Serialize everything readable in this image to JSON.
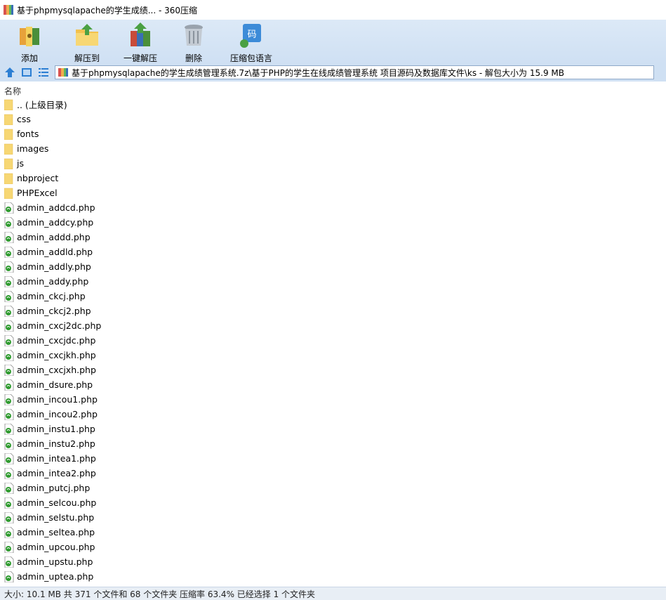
{
  "window": {
    "title": "基于phpmysqlapache的学生成绩... - 360压缩"
  },
  "toolbar": {
    "buttons": [
      {
        "label": "添加",
        "icon": "add-archive-icon"
      },
      {
        "label": "解压到",
        "icon": "extract-to-icon"
      },
      {
        "label": "一键解压",
        "icon": "quick-extract-icon"
      },
      {
        "label": "删除",
        "icon": "delete-trash-icon"
      },
      {
        "label": "压缩包语言",
        "icon": "archive-language-icon"
      }
    ]
  },
  "address": {
    "path": "基于phpmysqlapache的学生成绩管理系统.7z\\基于PHP的学生在线成绩管理系统 项目源码及数据库文件\\ks - 解包大小为 15.9 MB"
  },
  "columns": {
    "name": "名称"
  },
  "files": [
    {
      "name": ".. (上级目录)",
      "type": "folder"
    },
    {
      "name": "css",
      "type": "folder"
    },
    {
      "name": "fonts",
      "type": "folder"
    },
    {
      "name": "images",
      "type": "folder"
    },
    {
      "name": "js",
      "type": "folder"
    },
    {
      "name": "nbproject",
      "type": "folder"
    },
    {
      "name": "PHPExcel",
      "type": "folder"
    },
    {
      "name": "admin_addcd.php",
      "type": "php"
    },
    {
      "name": "admin_addcy.php",
      "type": "php"
    },
    {
      "name": "admin_addd.php",
      "type": "php"
    },
    {
      "name": "admin_addld.php",
      "type": "php"
    },
    {
      "name": "admin_addly.php",
      "type": "php"
    },
    {
      "name": "admin_addy.php",
      "type": "php"
    },
    {
      "name": "admin_ckcj.php",
      "type": "php"
    },
    {
      "name": "admin_ckcj2.php",
      "type": "php"
    },
    {
      "name": "admin_cxcj2dc.php",
      "type": "php"
    },
    {
      "name": "admin_cxcjdc.php",
      "type": "php"
    },
    {
      "name": "admin_cxcjkh.php",
      "type": "php"
    },
    {
      "name": "admin_cxcjxh.php",
      "type": "php"
    },
    {
      "name": "admin_dsure.php",
      "type": "php"
    },
    {
      "name": "admin_incou1.php",
      "type": "php"
    },
    {
      "name": "admin_incou2.php",
      "type": "php"
    },
    {
      "name": "admin_instu1.php",
      "type": "php"
    },
    {
      "name": "admin_instu2.php",
      "type": "php"
    },
    {
      "name": "admin_intea1.php",
      "type": "php"
    },
    {
      "name": "admin_intea2.php",
      "type": "php"
    },
    {
      "name": "admin_putcj.php",
      "type": "php"
    },
    {
      "name": "admin_selcou.php",
      "type": "php"
    },
    {
      "name": "admin_selstu.php",
      "type": "php"
    },
    {
      "name": "admin_seltea.php",
      "type": "php"
    },
    {
      "name": "admin_upcou.php",
      "type": "php"
    },
    {
      "name": "admin_upstu.php",
      "type": "php"
    },
    {
      "name": "admin_uptea.php",
      "type": "php"
    }
  ],
  "status": {
    "text": "大小: 10.1 MB 共 371 个文件和 68 个文件夹 压缩率 63.4% 已经选择 1 个文件夹"
  },
  "colors": {
    "toolbar_bg": "#cfe0f3",
    "folder": "#f7d774",
    "php_green": "#2f9a2f"
  }
}
